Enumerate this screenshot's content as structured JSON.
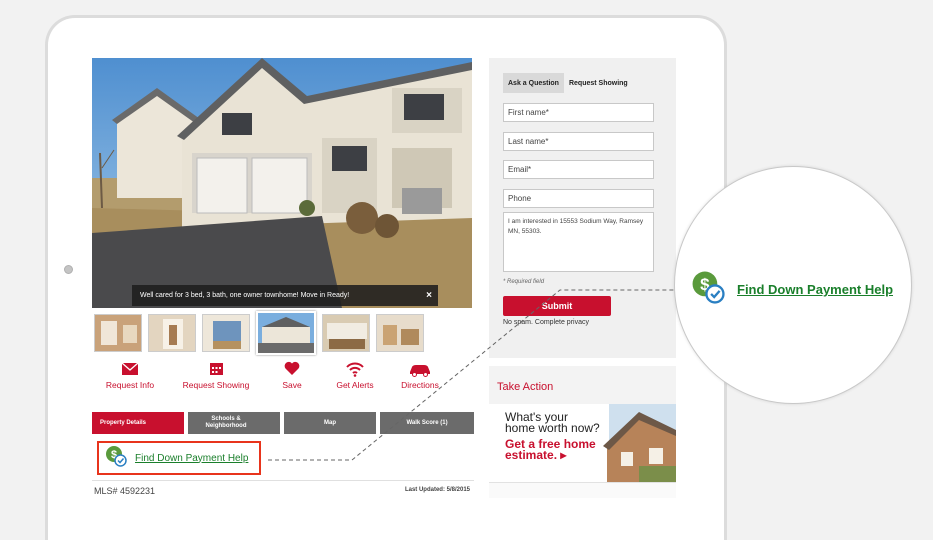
{
  "listing": {
    "caption": "Well cared for 3 bed, 3 bath, one owner townhome! Move in Ready!",
    "caption_close": "×",
    "thumbnail_count": 6
  },
  "actions": {
    "request_info": "Request Info",
    "request_showing": "Request Showing",
    "save": "Save",
    "get_alerts": "Get Alerts",
    "directions": "Directions"
  },
  "tabs": {
    "property_details": "Property Details",
    "schools": "Schools & Neighborhood",
    "map": "Map",
    "walk_score": "Walk Score (1)"
  },
  "down_payment": {
    "link_text": "Find Down Payment Help"
  },
  "mls": {
    "number": "MLS# 4592231",
    "last_updated": "Last Updated: 5/8/2015"
  },
  "contact_form": {
    "tab_ask": "Ask a Question",
    "tab_request": "Request Showing",
    "first_name": "First name*",
    "last_name": "Last name*",
    "email": "Email*",
    "phone": "Phone",
    "message": "I am interested in 15553 Sodium Way, Ramsey MN, 55303.",
    "required_note": "* Required field",
    "submit": "Submit",
    "privacy": "No spam. Complete privacy"
  },
  "take_action": {
    "title": "Take Action",
    "ad_headline": "What's your home worth now?",
    "ad_cta": "Get a free home estimate. ▸"
  },
  "callout": {
    "link_text": "Find Down Payment Help"
  },
  "colors": {
    "brand_red": "#c8102e",
    "link_green": "#1a7f2b",
    "highlight_orange": "#e8341c"
  }
}
